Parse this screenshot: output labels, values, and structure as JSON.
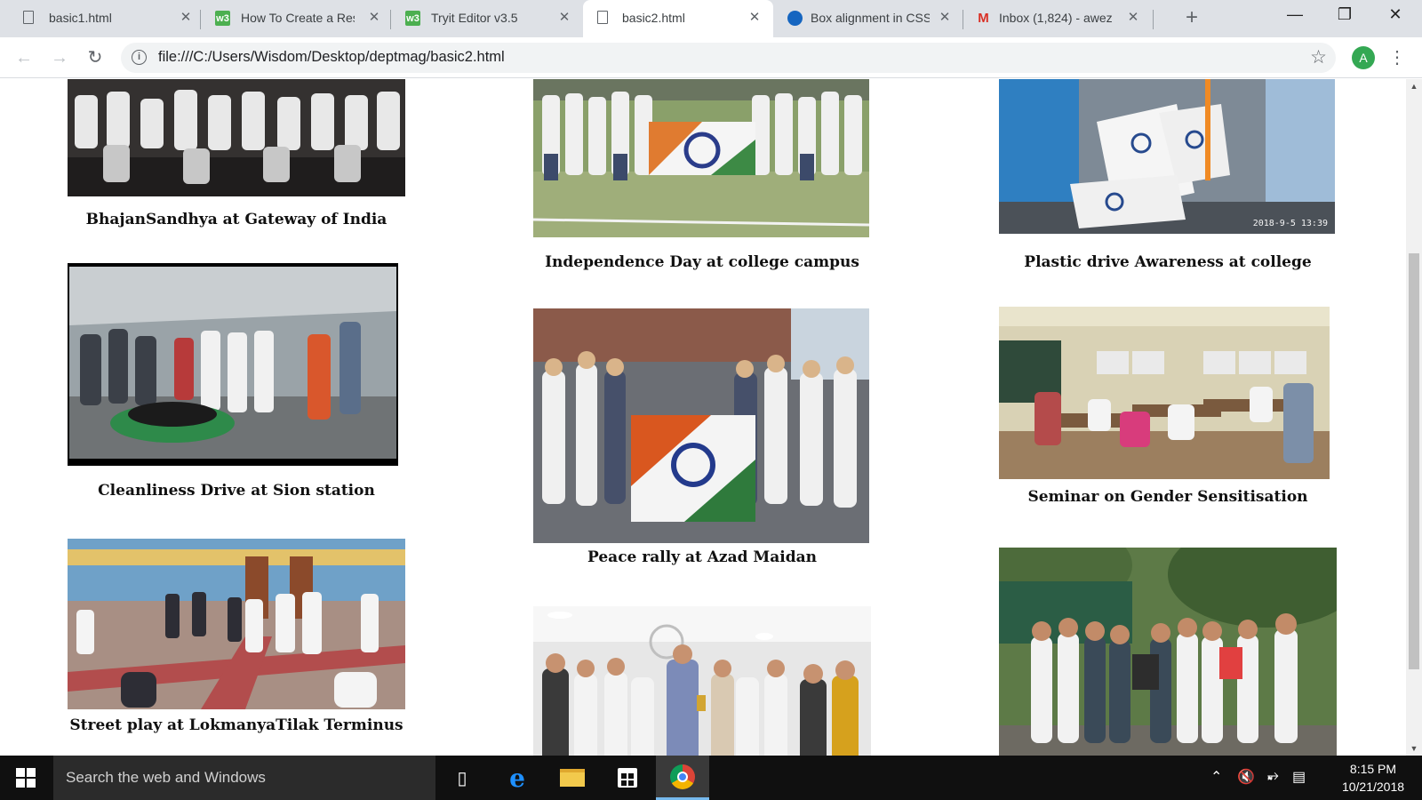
{
  "browser": {
    "tabs": [
      {
        "title": "basic1.html",
        "icon": "document-icon",
        "active": false
      },
      {
        "title": "How To Create a Res",
        "icon": "w3schools-icon",
        "active": false
      },
      {
        "title": "Tryit Editor v3.5",
        "icon": "w3schools-icon",
        "active": false
      },
      {
        "title": "basic2.html",
        "icon": "document-icon",
        "active": true
      },
      {
        "title": "Box alignment in CSS",
        "icon": "mdn-icon",
        "active": false
      },
      {
        "title": "Inbox (1,824) - awez",
        "icon": "gmail-icon",
        "active": false
      }
    ],
    "w3_glyph": "w3",
    "gmail_glyph": "M",
    "url": "file:///C:/Users/Wisdom/Desktop/deptmag/basic2.html",
    "profile_initial": "A"
  },
  "gallery": [
    {
      "caption": "BhajanSandhya at Gateway of India"
    },
    {
      "caption": "Independence Day at college campus"
    },
    {
      "caption": "Plastic drive Awareness at college"
    },
    {
      "caption": "Cleanliness Drive at Sion station"
    },
    {
      "caption": "Peace rally at Azad Maidan"
    },
    {
      "caption": "Seminar on Gender Sensitisation"
    },
    {
      "caption": "Street play at LokmanyaTilak Terminus"
    },
    {
      "caption": ""
    },
    {
      "caption": ""
    }
  ],
  "photo_stamp": "2018-9-5 13:39",
  "taskbar": {
    "search_placeholder": "Search the web and Windows",
    "time": "8:15 PM",
    "date": "10/21/2018"
  },
  "colors": {
    "tab_strip": "#dee1e6",
    "taskbar": "#101010",
    "active_indicator": "#76b9ed",
    "profile": "#34a853"
  }
}
